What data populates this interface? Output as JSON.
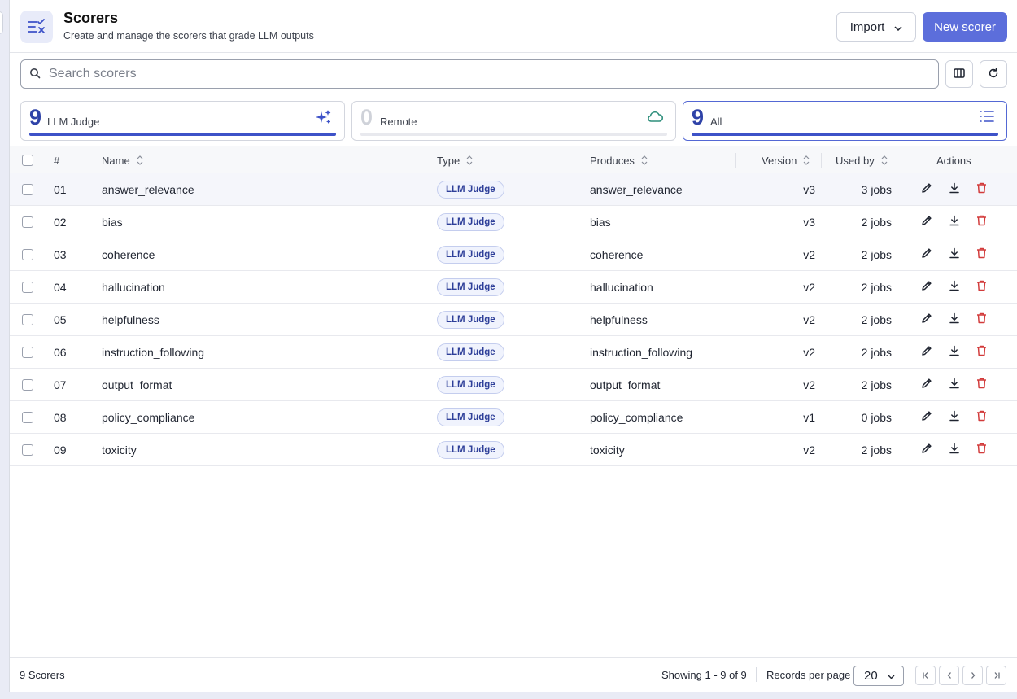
{
  "header": {
    "title": "Scorers",
    "subtitle": "Create and manage the scorers that grade LLM outputs",
    "import_label": "Import",
    "new_label": "New scorer"
  },
  "search": {
    "placeholder": "Search scorers",
    "value": ""
  },
  "cards": [
    {
      "count": "9",
      "label": "LLM Judge",
      "icon": "sparkles-icon",
      "progress": 1.0
    },
    {
      "count": "0",
      "label": "Remote",
      "icon": "cloud-icon",
      "progress": 0.0
    },
    {
      "count": "9",
      "label": "All",
      "icon": "list-icon",
      "progress": 1.0
    }
  ],
  "columns": {
    "num": "#",
    "name": "Name",
    "type": "Type",
    "produces": "Produces",
    "version": "Version",
    "used_by": "Used by",
    "actions": "Actions"
  },
  "rows": [
    {
      "num": "01",
      "name": "answer_relevance",
      "type": "LLM Judge",
      "produces": "answer_relevance",
      "version": "v3",
      "used_by": "3 jobs"
    },
    {
      "num": "02",
      "name": "bias",
      "type": "LLM Judge",
      "produces": "bias",
      "version": "v3",
      "used_by": "2 jobs"
    },
    {
      "num": "03",
      "name": "coherence",
      "type": "LLM Judge",
      "produces": "coherence",
      "version": "v2",
      "used_by": "2 jobs"
    },
    {
      "num": "04",
      "name": "hallucination",
      "type": "LLM Judge",
      "produces": "hallucination",
      "version": "v2",
      "used_by": "2 jobs"
    },
    {
      "num": "05",
      "name": "helpfulness",
      "type": "LLM Judge",
      "produces": "helpfulness",
      "version": "v2",
      "used_by": "2 jobs"
    },
    {
      "num": "06",
      "name": "instruction_following",
      "type": "LLM Judge",
      "produces": "instruction_following",
      "version": "v2",
      "used_by": "2 jobs"
    },
    {
      "num": "07",
      "name": "output_format",
      "type": "LLM Judge",
      "produces": "output_format",
      "version": "v2",
      "used_by": "2 jobs"
    },
    {
      "num": "08",
      "name": "policy_compliance",
      "type": "LLM Judge",
      "produces": "policy_compliance",
      "version": "v1",
      "used_by": "0 jobs"
    },
    {
      "num": "09",
      "name": "toxicity",
      "type": "LLM Judge",
      "produces": "toxicity",
      "version": "v2",
      "used_by": "2 jobs"
    }
  ],
  "footer": {
    "total": "9 Scorers",
    "showing": "Showing 1 - 9 of 9",
    "records_label": "Records per page",
    "page_size": "20"
  },
  "colors": {
    "accent": "#5c6edb",
    "progress": "#3d52c8",
    "delete": "#d23b3b"
  }
}
